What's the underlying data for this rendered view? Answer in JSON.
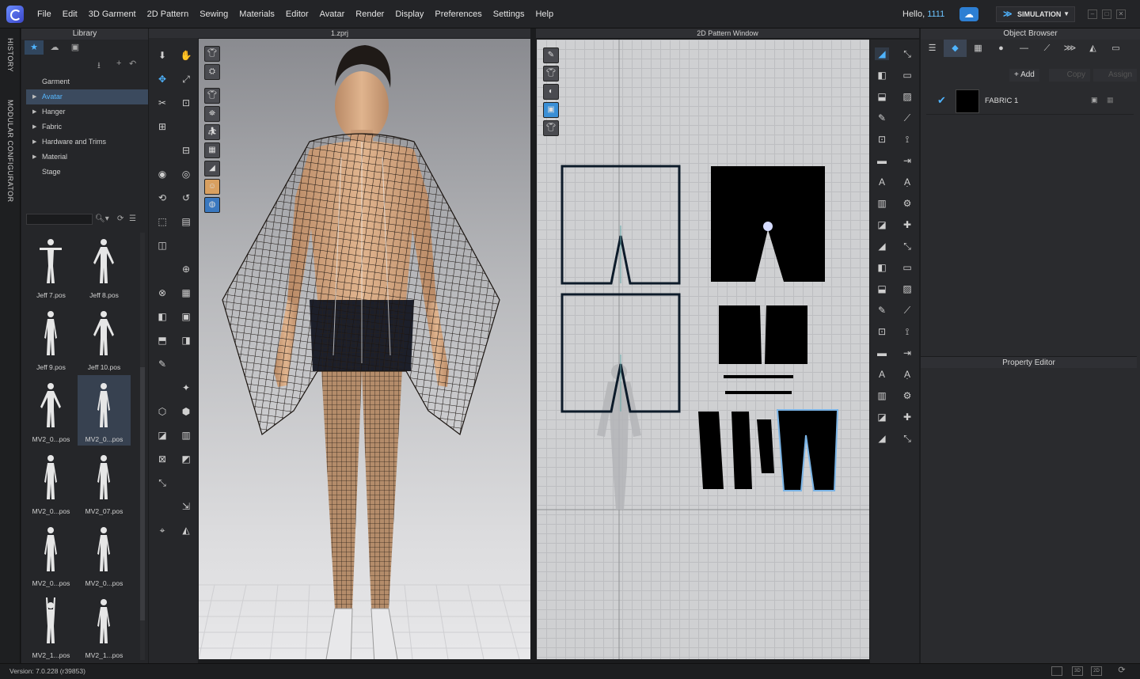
{
  "app": {
    "menu": [
      "File",
      "Edit",
      "3D Garment",
      "2D Pattern",
      "Sewing",
      "Materials",
      "Editor",
      "Avatar",
      "Render",
      "Display",
      "Preferences",
      "Settings",
      "Help"
    ],
    "greeting": "Hello,",
    "username": "1111",
    "simulation_label": "SIMULATION",
    "version": "Version: 7.0.228 (r39853)"
  },
  "sidebar_tabs": {
    "history": "HISTORY",
    "modular": "MODULAR CONFIGURATOR"
  },
  "library": {
    "title": "Library",
    "tree": [
      {
        "label": "Garment",
        "expandable": false,
        "selected": false
      },
      {
        "label": "Avatar",
        "expandable": true,
        "selected": true
      },
      {
        "label": "Hanger",
        "expandable": true,
        "selected": false
      },
      {
        "label": "Fabric",
        "expandable": true,
        "selected": false
      },
      {
        "label": "Hardware and Trims",
        "expandable": true,
        "selected": false
      },
      {
        "label": "Material",
        "expandable": true,
        "selected": false
      },
      {
        "label": "Stage",
        "expandable": false,
        "selected": false
      }
    ],
    "thumbnails": [
      {
        "label": "Jeff 7.pos",
        "pose": "t"
      },
      {
        "label": "Jeff 8.pos",
        "pose": "a"
      },
      {
        "label": "Jeff 9.pos",
        "pose": "down"
      },
      {
        "label": "Jeff 10.pos",
        "pose": "a"
      },
      {
        "label": "MV2_0...pos",
        "pose": "a"
      },
      {
        "label": "MV2_0...pos",
        "pose": "down",
        "selected": true
      },
      {
        "label": "MV2_0...pos",
        "pose": "down"
      },
      {
        "label": "MV2_07.pos",
        "pose": "down"
      },
      {
        "label": "MV2_0...pos",
        "pose": "down"
      },
      {
        "label": "MV2_0...pos",
        "pose": "down"
      },
      {
        "label": "MV2_1...pos",
        "pose": "up"
      },
      {
        "label": "MV2_1...pos",
        "pose": "down"
      }
    ]
  },
  "window3d": {
    "title": "1.zprj"
  },
  "window2d": {
    "title": "2D Pattern Window"
  },
  "object_browser": {
    "title": "Object Browser",
    "add_label": "+ Add",
    "copy_label": "Copy",
    "assign_label": "Assign",
    "fabrics": [
      {
        "name": "FABRIC 1",
        "color": "#000000",
        "checked": true
      }
    ]
  },
  "property_editor": {
    "title": "Property Editor"
  },
  "colors": {
    "accent": "#4fb4ff",
    "background": "#1b1c1e",
    "panel": "#2a2b2e"
  }
}
